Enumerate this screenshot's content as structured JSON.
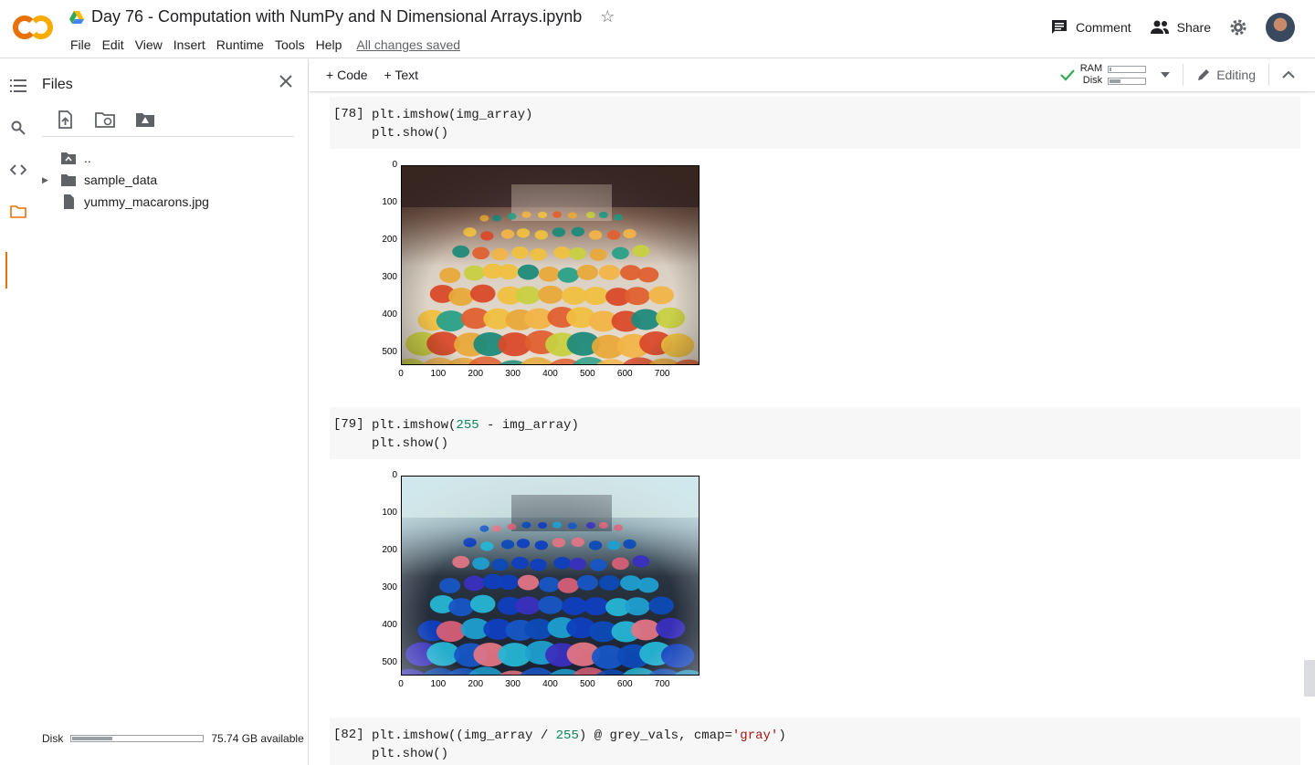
{
  "app": {
    "title": "Day 76 - Computation with NumPy and N Dimensional Arrays.ipynb",
    "menu": [
      "File",
      "Edit",
      "View",
      "Insert",
      "Runtime",
      "Tools",
      "Help"
    ],
    "saved_status": "All changes saved",
    "comment_label": "Comment",
    "share_label": "Share"
  },
  "files_panel": {
    "title": "Files",
    "items": [
      {
        "name": "..",
        "type": "parent"
      },
      {
        "name": "sample_data",
        "type": "folder"
      },
      {
        "name": "yummy_macarons.jpg",
        "type": "file"
      }
    ],
    "disk_label": "Disk",
    "disk_available": "75.74 GB available",
    "disk_fraction": 0.3
  },
  "toolbar": {
    "code_label": "Code",
    "text_label": "Text",
    "ram_label": "RAM",
    "disk_label": "Disk",
    "ram_fraction": 0.05,
    "disk_fraction": 0.3,
    "editing_label": "Editing"
  },
  "cells": [
    {
      "prompt": "[78]",
      "lines": [
        "plt.imshow(img_array)",
        "plt.show()"
      ]
    },
    {
      "prompt": "[79]",
      "lines": [
        "plt.imshow(255 - img_array)",
        "plt.show()"
      ]
    },
    {
      "prompt": "[82]",
      "lines": [
        "plt.imshow((img_array / 255) @ grey_vals, cmap='gray')",
        "plt.show()"
      ]
    }
  ],
  "figure_axes": {
    "y_ticks": [
      "0",
      "100",
      "200",
      "300",
      "400",
      "500"
    ],
    "x_ticks": [
      "0",
      "100",
      "200",
      "300",
      "400",
      "500",
      "600",
      "700"
    ]
  },
  "colors": {
    "accent": "#e8710a",
    "logo_orange": "#f9ab00",
    "green_check": "#34a853"
  }
}
